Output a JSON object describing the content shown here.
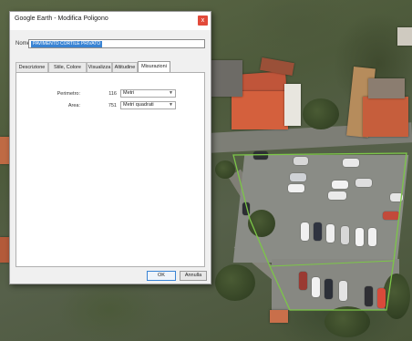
{
  "window": {
    "title": "Google Earth - Modifica Poligono",
    "close_glyph": "x"
  },
  "name_field": {
    "label": "Nome:",
    "value": "PAVIMENTO CORTILE PRIVATO"
  },
  "tabs": [
    {
      "label": "Descrizione"
    },
    {
      "label": "Stile, Colore"
    },
    {
      "label": "Visualizza"
    },
    {
      "label": "Altitudine"
    },
    {
      "label": "Misurazioni",
      "active": true
    }
  ],
  "measurements": {
    "perimeter": {
      "label": "Perimetro:",
      "value": "116",
      "unit": "Metri"
    },
    "area": {
      "label": "Area:",
      "value": "751",
      "unit": "Metri quadrati"
    }
  },
  "buttons": {
    "ok": "OK",
    "cancel": "Annulla"
  },
  "colors": {
    "polygon_outline": "#7cc648",
    "selection": "#3a84d4",
    "close_button": "#e24a3a"
  }
}
